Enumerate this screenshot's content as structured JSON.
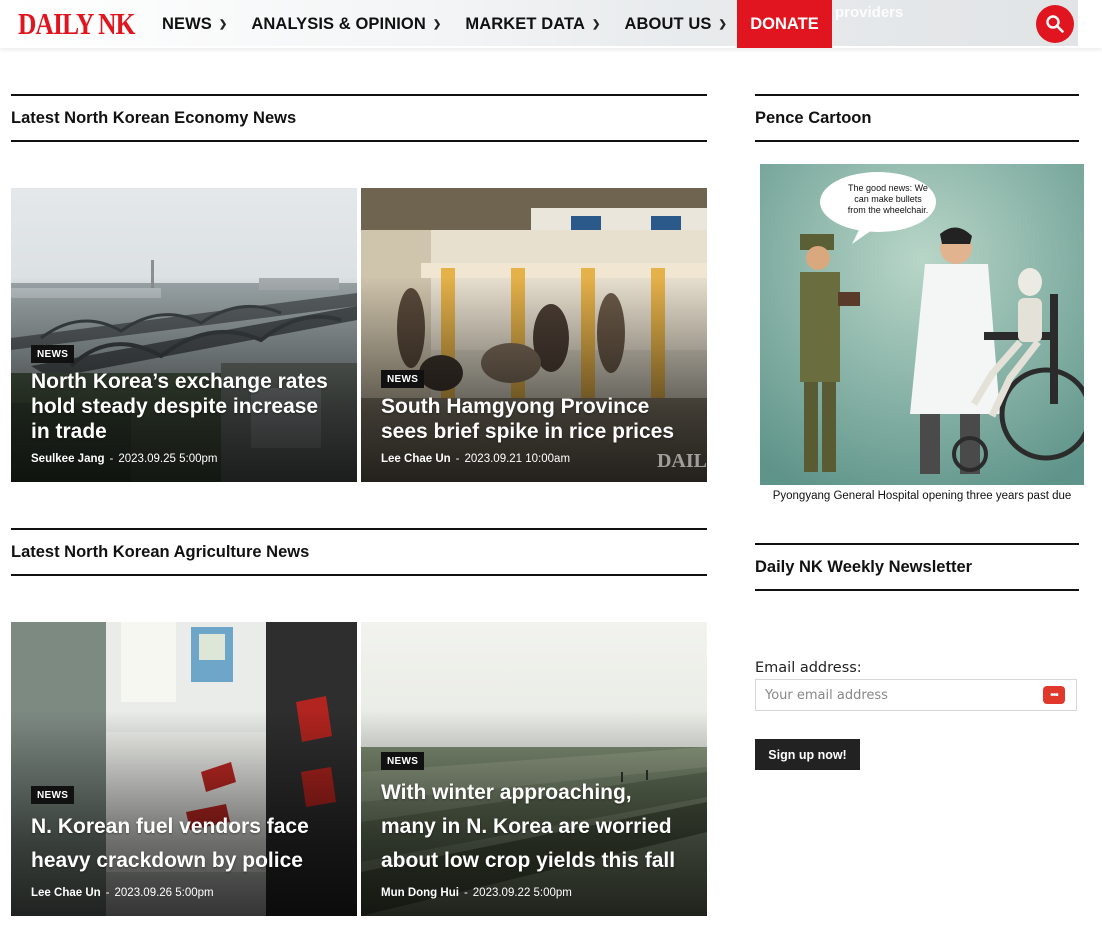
{
  "header": {
    "logo": "DAILY NK",
    "background_text": "providers",
    "nav": [
      {
        "label": "NEWS"
      },
      {
        "label": "ANALYSIS & OPINION"
      },
      {
        "label": "MARKET DATA"
      },
      {
        "label": "ABOUT US"
      }
    ],
    "donate_label": "DONATE",
    "accent_color": "#e0151f"
  },
  "economy": {
    "heading": "Latest North Korean Economy News",
    "cards": [
      {
        "badge": "NEWS",
        "title": "North Korea’s exchange rates hold steady despite increase in trade",
        "author": "Seulkee Jang",
        "date": "2023.09.25 5:00pm"
      },
      {
        "badge": "NEWS",
        "title": "South Hamgyong Province sees brief spike in rice prices",
        "author": "Lee Chae Un",
        "date": "2023.09.21 10:00am",
        "watermark": "DAIL"
      }
    ]
  },
  "agriculture": {
    "heading": "Latest North Korean Agriculture News",
    "cards": [
      {
        "badge": "NEWS",
        "title": "N. Korean fuel vendors face heavy crackdown by police",
        "author": "Lee Chae Un",
        "date": "2023.09.26 5:00pm"
      },
      {
        "badge": "NEWS",
        "title": "With winter approaching, many in N. Korea are worried about low crop yields this fall",
        "author": "Mun Dong Hui",
        "date": "2023.09.22 5:00pm"
      }
    ]
  },
  "sidebar": {
    "cartoon_heading": "Pence Cartoon",
    "cartoon_speech": "The good news: We can make bullets from the wheelchair.",
    "cartoon_caption": "Pyongyang General Hospital opening three years past due",
    "newsletter_heading": "Daily NK Weekly Newsletter",
    "email_label": "Email address:",
    "email_placeholder": "Your email address",
    "email_value": "",
    "signup_label": "Sign up now!"
  },
  "date_separator": "-"
}
